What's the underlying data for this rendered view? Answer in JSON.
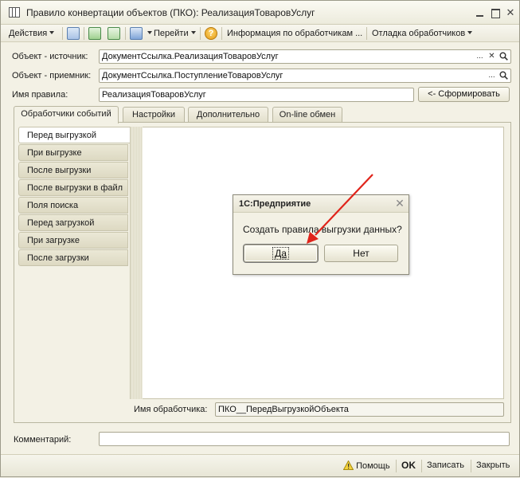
{
  "window": {
    "title": "Правило конвертации объектов (ПКО): РеализацияТоваровУслуг"
  },
  "toolbar": {
    "actions_label": "Действия",
    "goto_label": "Перейти",
    "handlers_info_label": "Информация по обработчикам ...",
    "debug_label": "Отладка обработчиков"
  },
  "form": {
    "source_label": "Объект - источник:",
    "source_value": "ДокументСсылка.РеализацияТоваровУслуг",
    "target_label": "Объект - приемник:",
    "target_value": "ДокументСсылка.ПоступлениеТоваровУслуг",
    "rule_name_label": "Имя правила:",
    "rule_name_value": "РеализацияТоваровУслуг",
    "generate_button": "<- Сформировать",
    "comment_label": "Комментарий:",
    "comment_value": ""
  },
  "tabs": [
    {
      "label": "Обработчики событий"
    },
    {
      "label": "Настройки"
    },
    {
      "label": "Дополнительно"
    },
    {
      "label": "On-line обмен"
    }
  ],
  "events": [
    {
      "label": "Перед выгрузкой"
    },
    {
      "label": "При выгрузке"
    },
    {
      "label": "После выгрузки"
    },
    {
      "label": "После выгрузки в файл"
    },
    {
      "label": "Поля поиска"
    },
    {
      "label": "Перед загрузкой"
    },
    {
      "label": "При загрузке"
    },
    {
      "label": "После загрузки"
    }
  ],
  "handler": {
    "label": "Имя обработчика:",
    "value": "ПКО__ПередВыгрузкойОбъекта"
  },
  "dialog": {
    "title": "1С:Предприятие",
    "message": "Создать правила выгрузки данных?",
    "yes": "Да",
    "no": "Нет"
  },
  "statusbar": {
    "help": "Помощь",
    "ok": "OK",
    "save": "Записать",
    "close": "Закрыть"
  },
  "colors": {
    "annotation_arrow": "#e0241b"
  }
}
